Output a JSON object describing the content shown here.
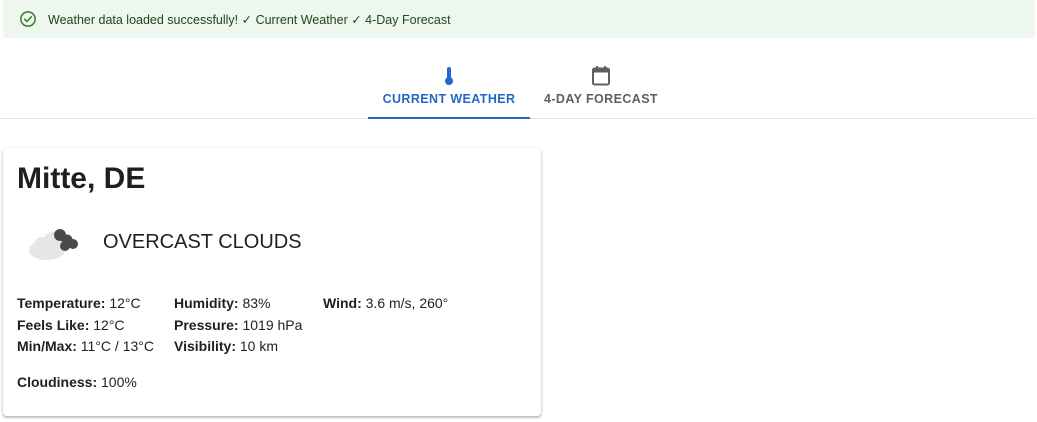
{
  "alert": {
    "message": "Weather data loaded successfully! ✓ Current Weather ✓ 4-Day Forecast",
    "icon": "check-circle-icon",
    "color": "#2e7d32"
  },
  "tabs": [
    {
      "label": "CURRENT WEATHER",
      "icon": "thermometer-icon",
      "active": true
    },
    {
      "label": "4-DAY FORECAST",
      "icon": "calendar-icon",
      "active": false
    }
  ],
  "current": {
    "location": "Mitte, DE",
    "condition": "OVERCAST CLOUDS",
    "weather_icon": "overcast-clouds-icon",
    "stats": {
      "temperature": {
        "label": "Temperature:",
        "value": "12°C"
      },
      "feels_like": {
        "label": "Feels Like:",
        "value": "12°C"
      },
      "min_max": {
        "label": "Min/Max:",
        "value": "11°C / 13°C"
      },
      "humidity": {
        "label": "Humidity:",
        "value": "83%"
      },
      "pressure": {
        "label": "Pressure:",
        "value": "1019 hPa"
      },
      "visibility": {
        "label": "Visibility:",
        "value": "10 km"
      },
      "wind": {
        "label": "Wind:",
        "value": "3.6 m/s, 260°"
      },
      "cloudiness": {
        "label": "Cloudiness:",
        "value": "100%"
      }
    }
  },
  "colors": {
    "accent": "#2566c9",
    "alert_bg": "#edf7ed",
    "alert_text": "#1e4620"
  }
}
